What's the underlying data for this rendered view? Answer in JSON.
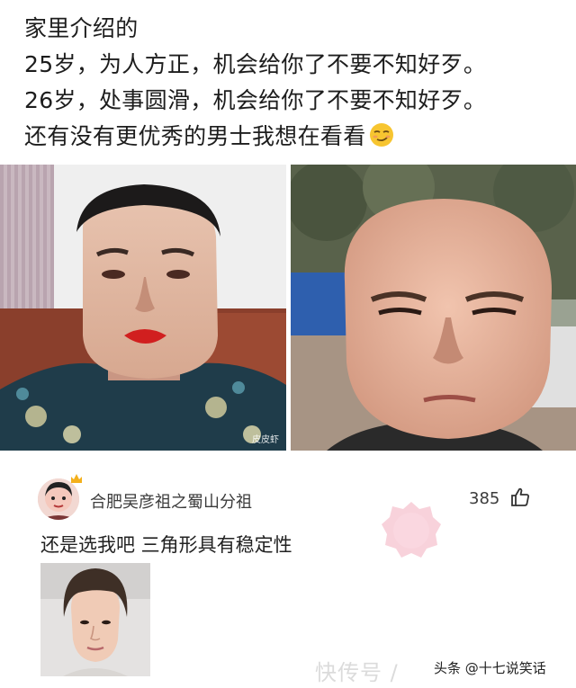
{
  "post": {
    "lines": [
      "家里介绍的",
      "25岁，为人方正，机会给你了不要不知好歹。",
      "26岁，处事圆滑，机会给你了不要不知好歹。",
      "还有没有更优秀的男士我想在看看"
    ],
    "emoji": "smirk-emoji"
  },
  "photos": {
    "left_watermark": "皮皮虾"
  },
  "comment": {
    "username": "合肥吴彦祖之蜀山分祖",
    "likes": "385",
    "text": "还是选我吧 三角形具有稳定性"
  },
  "watermark": {
    "faint": "快传号 / ",
    "source": "头条 @十七说笑话"
  },
  "colors": {
    "text": "#1d1d1d",
    "meta": "#3b3b3b",
    "stamp": "#f2a8b8"
  }
}
